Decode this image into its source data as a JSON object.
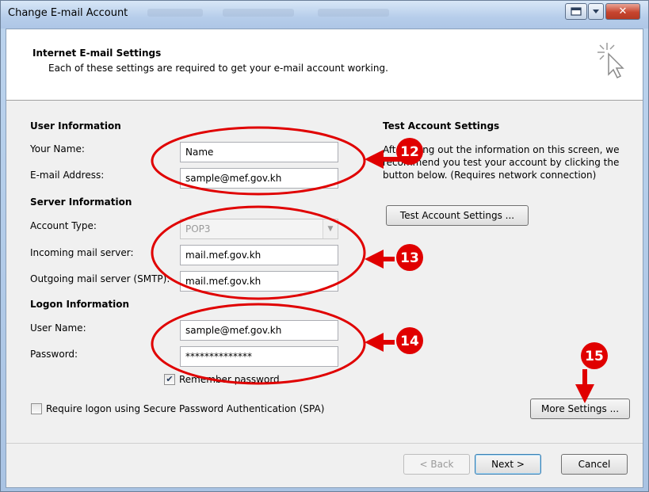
{
  "window": {
    "title": "Change E-mail Account",
    "controls": [
      "restore-icon",
      "dropdown-icon",
      "close-icon"
    ]
  },
  "header": {
    "title": "Internet E-mail Settings",
    "subtitle": "Each of these settings are required to get your e-mail account working."
  },
  "user_info": {
    "heading": "User Information",
    "name_label": "Your Name:",
    "name_value": "Name",
    "email_label": "E-mail Address:",
    "email_value": "sample@mef.gov.kh"
  },
  "server_info": {
    "heading": "Server Information",
    "account_type_label": "Account Type:",
    "account_type_value": "POP3",
    "incoming_label": "Incoming mail server:",
    "incoming_value": "mail.mef.gov.kh",
    "outgoing_label": "Outgoing mail server (SMTP):",
    "outgoing_value": "mail.mef.gov.kh"
  },
  "logon_info": {
    "heading": "Logon Information",
    "username_label": "User Name:",
    "username_value": "sample@mef.gov.kh",
    "password_label": "Password:",
    "password_value": "**************",
    "remember_label": "Remember password",
    "remember_checked": true,
    "spa_label": "Require logon using Secure Password Authentication (SPA)",
    "spa_checked": false
  },
  "test_settings": {
    "heading": "Test Account Settings",
    "line1": "After filling out the information on this screen, we",
    "line2": "recommend you test your account by clicking the",
    "line3": "button below. (Requires network connection)",
    "button_label": "Test Account Settings ..."
  },
  "buttons": {
    "more_settings": "More Settings ...",
    "back": "< Back",
    "next": "Next >",
    "cancel": "Cancel"
  },
  "annotations": {
    "color": "#ff0000",
    "badges": [
      "12",
      "13",
      "14",
      "15"
    ]
  }
}
